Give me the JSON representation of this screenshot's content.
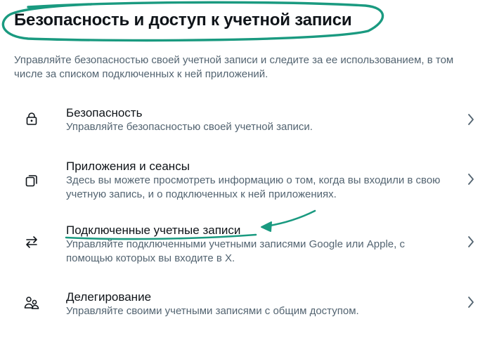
{
  "header": {
    "title": "Безопасность и доступ к учетной записи",
    "description": "Управляйте безопасностью своей учетной записи и следите за ее использованием, в том числе за списком подключенных к ней приложений."
  },
  "menu": {
    "items": [
      {
        "icon": "lock-icon",
        "title": "Безопасность",
        "description": "Управляйте безопасностью своей учетной записи."
      },
      {
        "icon": "copy-icon",
        "title": "Приложения и сеансы",
        "description": "Здесь вы можете просмотреть информацию о том, когда вы входили в свою учетную запись, и о подключенных к ней приложениях."
      },
      {
        "icon": "swap-arrows-icon",
        "title": "Подключенные учетные записи",
        "description": "Управляйте подключенными учетными записями Google или Apple, с помощью которых вы входите в X."
      },
      {
        "icon": "people-icon",
        "title": "Делегирование",
        "description": "Управляйте своими учетными записями с общим доступом."
      }
    ]
  },
  "colors": {
    "annotation": "#1a9a80",
    "primary_text": "#0f1419",
    "secondary_text": "#536471"
  }
}
